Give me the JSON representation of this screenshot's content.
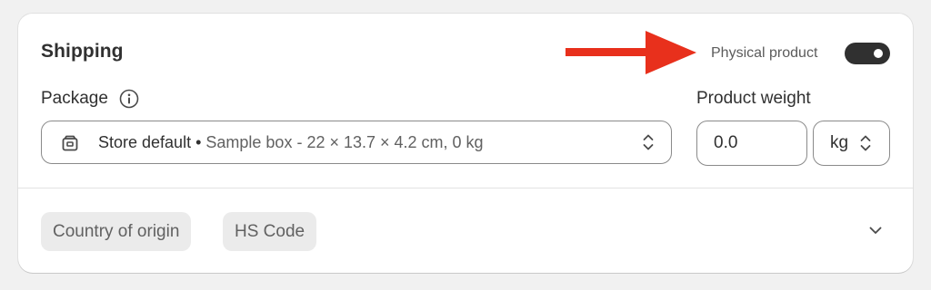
{
  "shipping": {
    "title": "Shipping",
    "physical_product_label": "Physical product",
    "physical_product_enabled": true,
    "annotation_arrow_color": "#e8301c"
  },
  "package": {
    "label": "Package",
    "info_icon": "info-icon",
    "selected_name": "Store default",
    "separator": " • ",
    "selected_detail": "Sample box - 22 × 13.7 × 4.2 cm, 0 kg",
    "icon": "package-icon"
  },
  "weight": {
    "label": "Product weight",
    "value": "0.0",
    "unit": "kg"
  },
  "customs": {
    "chips": [
      "Country of origin",
      "HS Code"
    ],
    "expand_icon": "chevron-down-icon"
  }
}
